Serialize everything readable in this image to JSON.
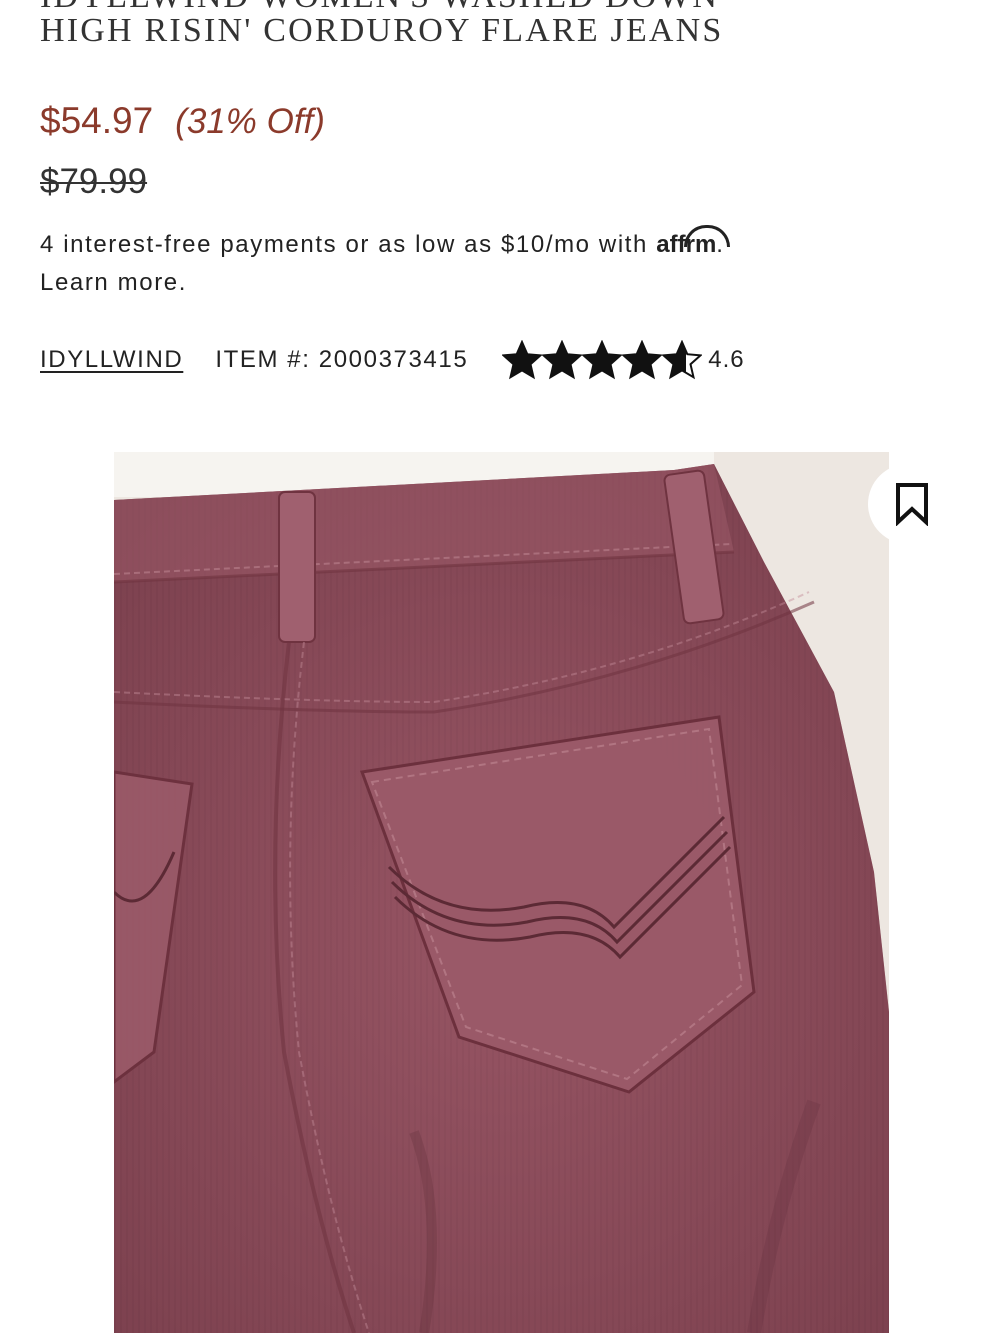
{
  "product": {
    "title_cut": "IDYLLWIND WOMEN'S WASHED DOWN",
    "title": "HIGH RISIN' CORDUROY FLARE JEANS",
    "price": "$54.97",
    "discount": "(31% Off)",
    "was_price": "$79.99",
    "brand": "IDYLLWIND",
    "item_number_label": "ITEM #: 2000373415",
    "rating": "4.6",
    "rating_value_numeric": 4.6,
    "rating_max": 5,
    "image_alt": "Women's washed corduroy flare jeans, back view"
  },
  "financing": {
    "text": "4 interest-free payments or as low as $10/mo with",
    "logo_text_pre": "aff",
    "logo_text_post": "rm",
    "period": ".",
    "learn_more": "Learn more."
  },
  "icons": {
    "bookmark": "bookmark-icon",
    "star": "star-icon"
  },
  "colors": {
    "price": "#8b3a2b",
    "text": "#222222",
    "jeans": "#8f4f5e"
  }
}
